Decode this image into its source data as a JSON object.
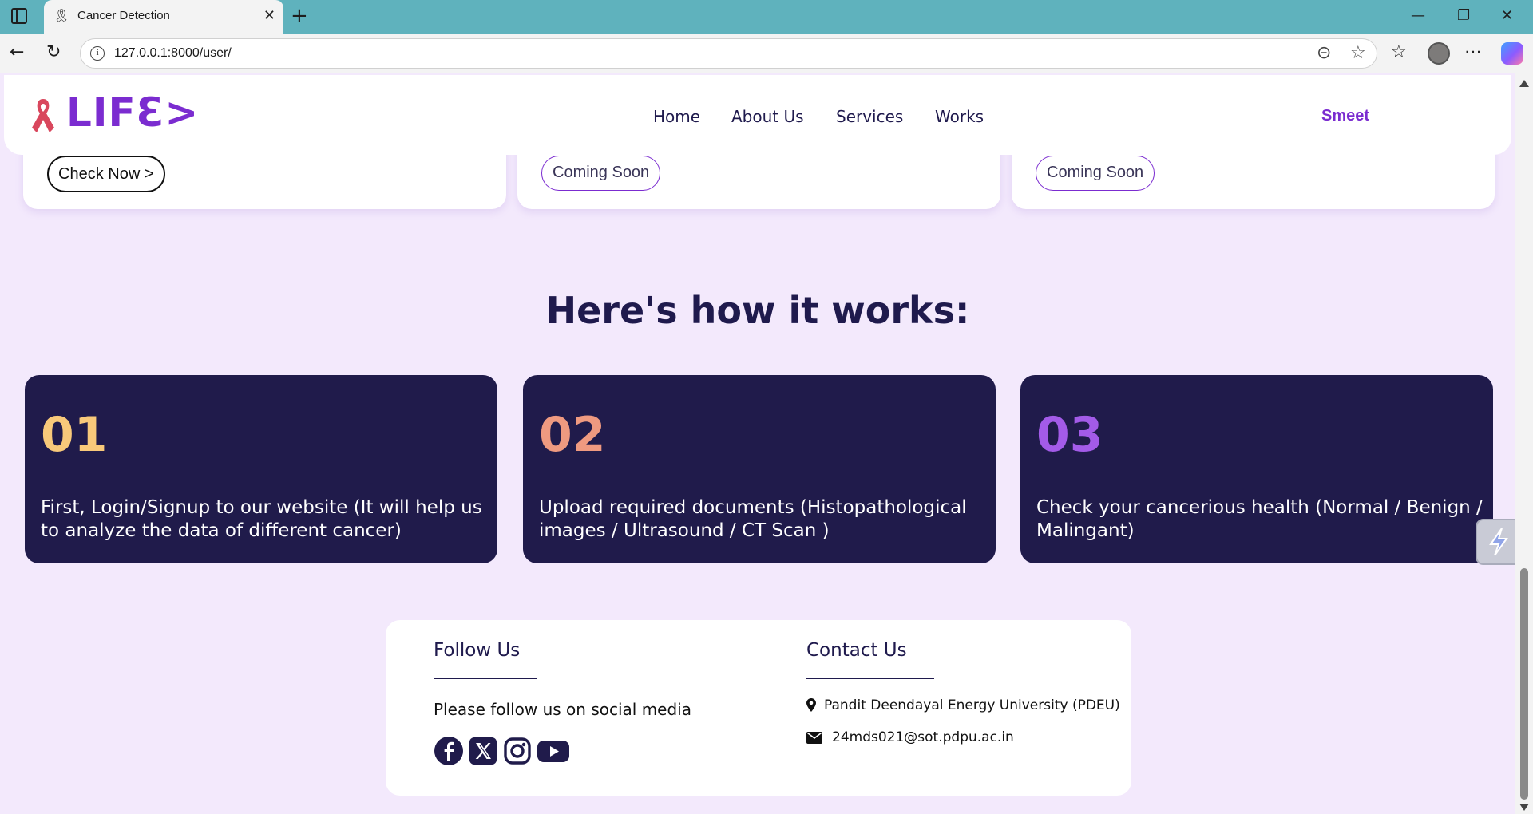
{
  "browser": {
    "tab_title": "Cancer Detection",
    "url": "127.0.0.1:8000/user/"
  },
  "header": {
    "logo_text": "LIFƐ>",
    "nav": [
      "Home",
      "About Us",
      "Services",
      "Works"
    ],
    "user_name": "Smeet"
  },
  "services": {
    "check_label": "Check Now >",
    "coming_soon_1": "Coming Soon",
    "coming_soon_2": "Coming Soon"
  },
  "how_it_works": {
    "title": "Here's how it works:",
    "steps": [
      {
        "num": "01",
        "color": "#f8c97a",
        "text": "First, Login/Signup to our website (It will help us to analyze the data of different cancer)"
      },
      {
        "num": "02",
        "color": "#ef9a80",
        "text": "Upload required documents (Histopathological images / Ultrasound / CT Scan )"
      },
      {
        "num": "03",
        "color": "#a35be8",
        "text": "Check your cancerious health (Normal / Benign / Malingant)"
      }
    ]
  },
  "footer": {
    "follow_title": "Follow Us",
    "follow_text": "Please follow us on social media",
    "social": [
      "facebook-icon",
      "x-icon",
      "instagram-icon",
      "youtube-icon"
    ],
    "contact_title": "Contact Us",
    "address": "Pandit Deendayal Energy University (PDEU)",
    "email": "24mds021@sot.pdpu.ac.in"
  },
  "colors": {
    "brand": "#7b2cd0",
    "navy": "#201b4b",
    "page_bg": "#f3e9fc"
  }
}
